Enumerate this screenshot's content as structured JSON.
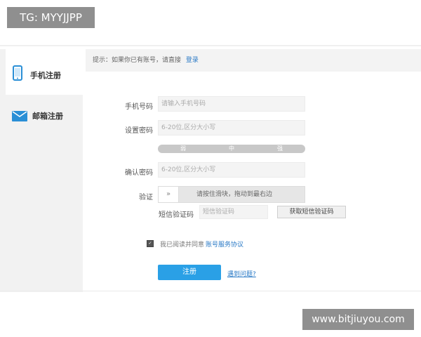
{
  "overlay": {
    "top_badge": "TG: MYYJJPP",
    "watermark": "www.bitjiuyou.com"
  },
  "sidebar": {
    "tabs": [
      {
        "label": "手机注册",
        "icon": "phone-icon",
        "active": true
      },
      {
        "label": "邮箱注册",
        "icon": "mail-icon",
        "active": false
      }
    ]
  },
  "notice": {
    "text": "提示：如果你已有账号，请直接",
    "login_link": "登录"
  },
  "form": {
    "phone": {
      "label": "手机号码",
      "placeholder": "请输入手机号码"
    },
    "password": {
      "label": "设置密码",
      "placeholder": "6-20位,区分大小写"
    },
    "strength": {
      "weak": "弱",
      "medium": "中",
      "strong": "强"
    },
    "confirm": {
      "label": "确认密码",
      "placeholder": "6-20位,区分大小写"
    },
    "verify": {
      "label": "验证",
      "handle": "»",
      "hint": "请按住滑块，拖动到最右边"
    },
    "sms": {
      "label": "短信验证码",
      "placeholder": "短信验证码",
      "button": "获取短信验证码"
    },
    "agreement": {
      "text": "我已阅读并同意",
      "link": "账号服务协议",
      "checked": true
    },
    "submit": "注册",
    "problem_link": "遇到问题?"
  },
  "colors": {
    "accent": "#2aa0e6",
    "link": "#2a7ac6",
    "sidebar_bg": "#f2f2f2"
  }
}
